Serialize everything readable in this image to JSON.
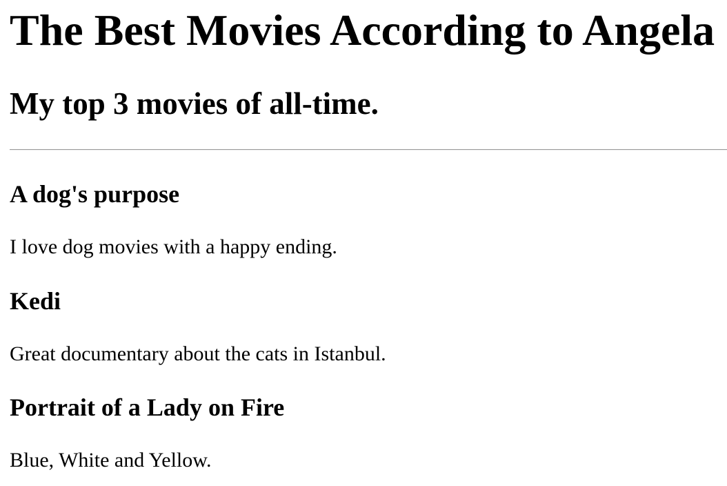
{
  "page": {
    "title": "The Best Movies According to Angela",
    "subtitle": "My top 3 movies of all-time."
  },
  "movies": [
    {
      "title": "A dog's purpose",
      "description": "I love dog movies with a happy ending."
    },
    {
      "title": "Kedi",
      "description": "Great documentary about the cats in Istanbul."
    },
    {
      "title": "Portrait of a Lady on Fire",
      "description": "Blue, White and Yellow."
    }
  ]
}
